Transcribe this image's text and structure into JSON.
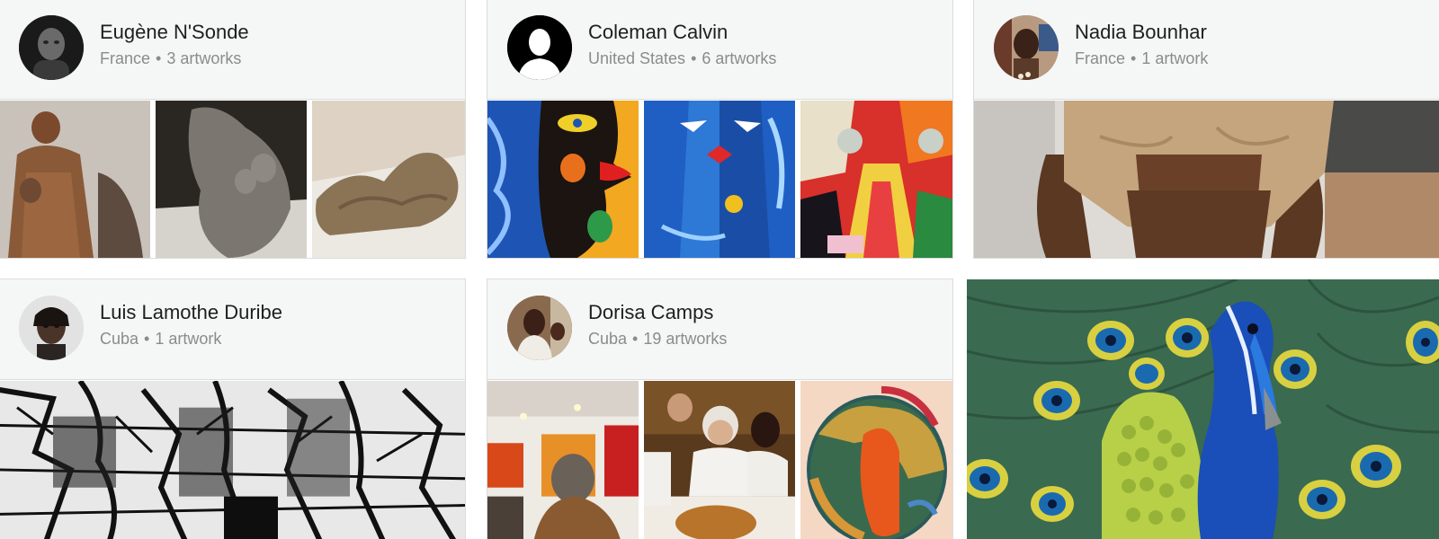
{
  "artists": [
    {
      "name": "Eugène N'Sonde",
      "country": "France",
      "count": "3 artworks",
      "avatar_icon": "portrait-photo"
    },
    {
      "name": "Coleman Calvin",
      "country": "United States",
      "count": "6 artworks",
      "avatar_icon": "default-user-silhouette"
    },
    {
      "name": "Nadia Bounhar",
      "country": "France",
      "count": "1 artwork",
      "avatar_icon": "portrait-photo"
    },
    {
      "name": "Luis Lamothe Duribe",
      "country": "Cuba",
      "count": "1 artwork",
      "avatar_icon": "portrait-photo"
    },
    {
      "name": "Dorisa Camps",
      "country": "Cuba",
      "count": "19 artworks",
      "avatar_icon": "portrait-photo"
    }
  ],
  "separator": "•",
  "colors": {
    "header_bg": "#f5f6f6",
    "border": "#dcdcdc",
    "name_text": "#1e1e1e",
    "meta_text": "#8b8b8b"
  }
}
